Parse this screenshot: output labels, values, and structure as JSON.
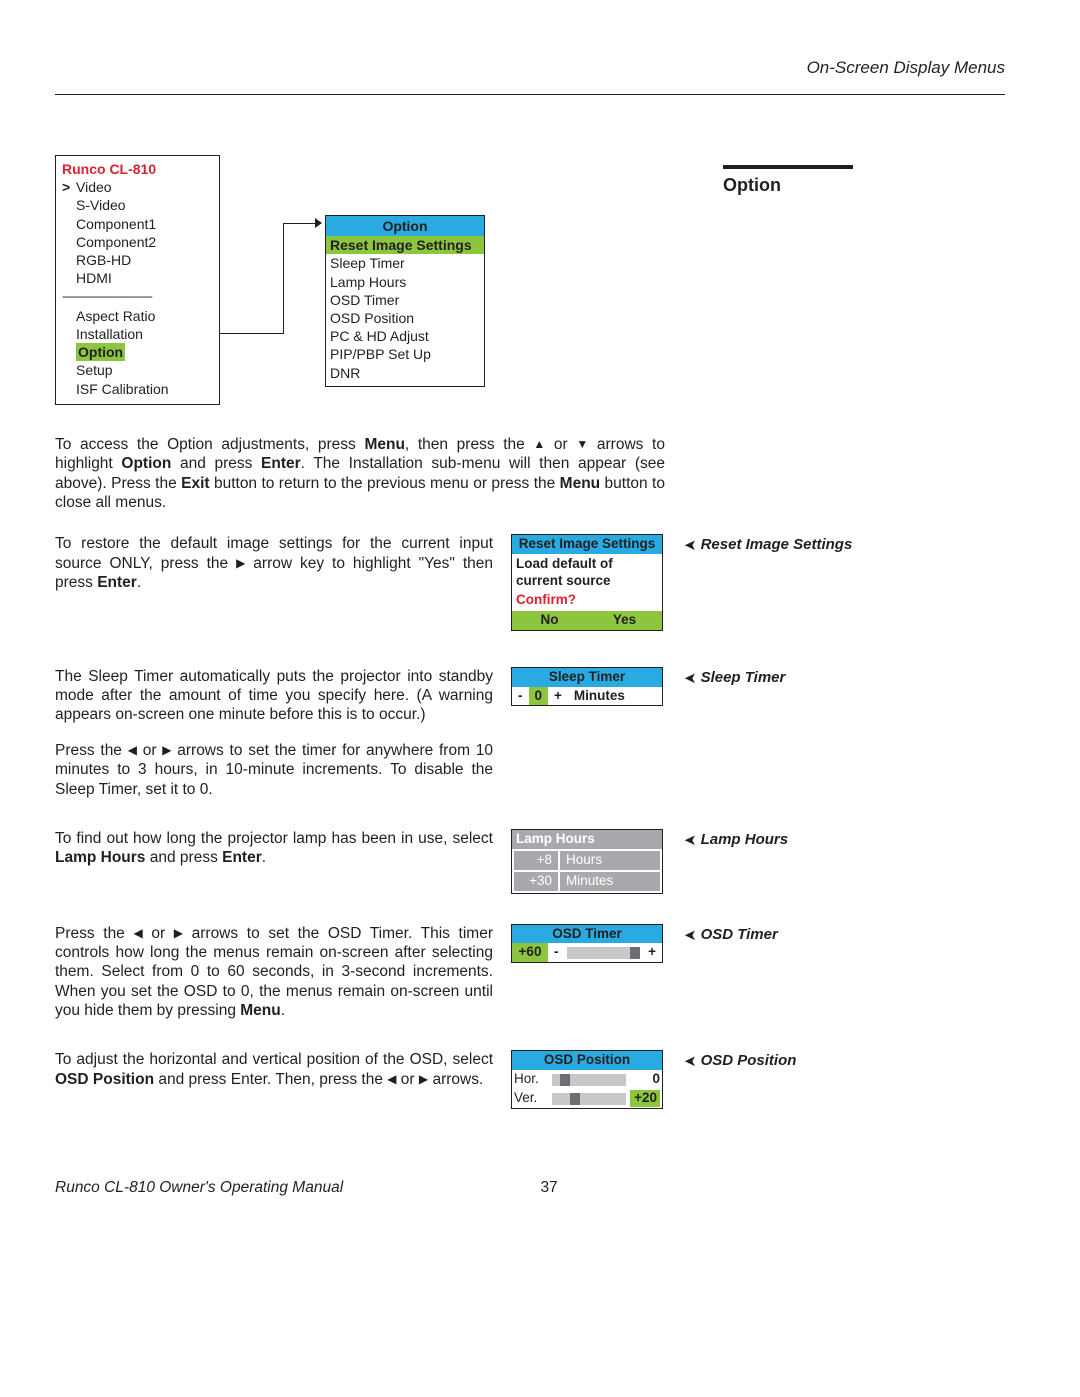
{
  "header": {
    "section": "On-Screen Display Menus"
  },
  "rightHeading": "Option",
  "mainMenu": {
    "title": "Runco CL-810",
    "items1": [
      "Video",
      "S-Video",
      "Component1",
      "Component2",
      "RGB-HD",
      "HDMI"
    ],
    "items2": [
      "Aspect Ratio",
      "Installation"
    ],
    "highlight": "Option",
    "items3": [
      "Setup",
      "ISF Calibration"
    ]
  },
  "optionMenu": {
    "title": "Option",
    "highlight": "Reset Image Settings",
    "items": [
      "Sleep Timer",
      "Lamp Hours",
      "OSD Timer",
      "OSD Position",
      "PC & HD Adjust",
      "PIP/PBP Set Up",
      "DNR"
    ]
  },
  "intro": {
    "p1a": "To access the Option adjustments, press ",
    "p1b": "Menu",
    "p1c": ", then press the ",
    "p1d": " or ",
    "p1e": " arrows to highlight ",
    "p1f": "Option",
    "p1g": " and press ",
    "p1h": "Enter",
    "p1i": ". The Installation sub-menu will then appear (see above). Press the ",
    "p1j": "Exit",
    "p1k": " button to return to the previous menu or press the ",
    "p1l": "Menu",
    "p1m": " button to close all menus."
  },
  "reset": {
    "label": "Reset Image Settings",
    "text_a": "To restore the default image settings for the current input source ONLY, press the ",
    "text_b": " arrow key to highlight \"Yes\" then press ",
    "text_c": "Enter",
    "text_d": ".",
    "box": {
      "title": "Reset Image Settings",
      "line1": "Load default of",
      "line2": "current source",
      "confirm": "Confirm?",
      "no": "No",
      "yes": "Yes"
    }
  },
  "sleep": {
    "label": "Sleep Timer",
    "p1": "The Sleep Timer automatically puts the projector into standby mode after the amount of time you specify here. (A warning appears on-screen one minute before this is to occur.)",
    "p2a": "Press the ",
    "p2b": " or ",
    "p2c": " arrows to set the timer for anywhere from 10 minutes to 3 hours, in 10-minute increments. To disable the Sleep Timer, set it to 0.",
    "box": {
      "title": "Sleep Timer",
      "minus": "-",
      "value": "0",
      "plus": "+",
      "unit": "Minutes"
    }
  },
  "lamp": {
    "label": "Lamp Hours",
    "text_a": "To find out how long the projector lamp has been in use, select ",
    "text_b": "Lamp Hours",
    "text_c": " and press ",
    "text_d": "Enter",
    "text_e": ".",
    "box": {
      "title": "Lamp Hours",
      "h": "+8",
      "hu": "Hours",
      "m": "+30",
      "mu": "Minutes"
    }
  },
  "osdTimer": {
    "label": "OSD Timer",
    "p_a": "Press the ",
    "p_b": " or ",
    "p_c": " arrows to set the OSD Timer. This timer controls how long the menus remain on-screen after selecting them. Select from 0 to 60 seconds, in 3-second increments. When you set the OSD to 0, the menus remain on-screen until you hide them by pressing ",
    "p_d": "Menu",
    "p_e": ".",
    "box": {
      "title": "OSD Timer",
      "value": "+60",
      "minus": "-",
      "plus": "+"
    }
  },
  "osdPos": {
    "label": "OSD Position",
    "p_a": "To adjust the horizontal and vertical position of the OSD, select ",
    "p_b": "OSD Position",
    "p_c": " and press Enter. Then, press the ",
    "p_d": " or ",
    "p_e": " arrows.",
    "box": {
      "title": "OSD Position",
      "hor": "Hor.",
      "horv": "0",
      "ver": "Ver.",
      "verv": "+20"
    }
  },
  "footer": {
    "left": "Runco CL-810 Owner's Operating Manual",
    "page": "37"
  }
}
